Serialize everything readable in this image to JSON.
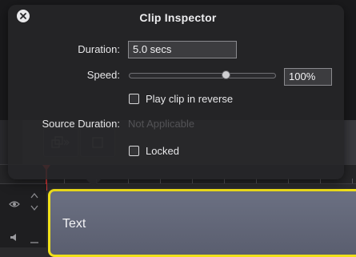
{
  "popover": {
    "title": "Clip Inspector",
    "close_icon": "close-icon",
    "duration": {
      "label": "Duration:",
      "value": "5.0 secs"
    },
    "speed": {
      "label": "Speed:",
      "value": "100%",
      "slider_position": 0.67
    },
    "reverse": {
      "label": "Play clip in reverse",
      "checked": false
    },
    "source_duration": {
      "label": "Source Duration:",
      "value": "Not Applicable"
    },
    "locked": {
      "label": "Locked",
      "checked": false
    }
  },
  "timeline": {
    "clip": {
      "label": "Text",
      "border_color": "#f0e01a"
    },
    "playhead_color": "#d63a3a",
    "track_icons": [
      "eye-icon",
      "up-down-arrows-icon",
      "speaker-icon"
    ],
    "toolbar_icons": [
      "add-clip-icon",
      "crop-icon"
    ]
  }
}
